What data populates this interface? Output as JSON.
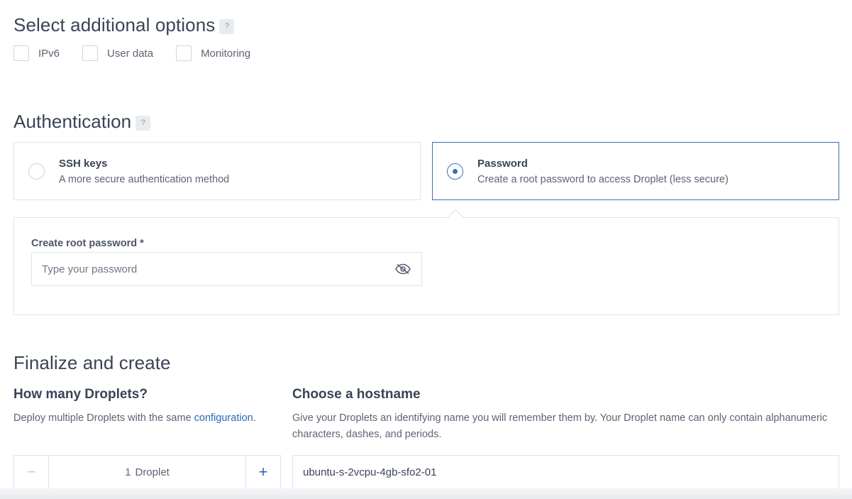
{
  "additional_options": {
    "heading": "Select additional options",
    "help": "?",
    "options": [
      {
        "label": "IPv6",
        "checked": false
      },
      {
        "label": "User data",
        "checked": false
      },
      {
        "label": "Monitoring",
        "checked": false
      }
    ]
  },
  "authentication": {
    "heading": "Authentication",
    "help": "?",
    "ssh": {
      "title": "SSH keys",
      "subtitle": "A more secure authentication method",
      "selected": false
    },
    "password": {
      "title": "Password",
      "subtitle": "Create a root password to access Droplet (less secure)",
      "selected": true
    },
    "root_password": {
      "label": "Create root password *",
      "placeholder": "Type your password",
      "value": ""
    }
  },
  "finalize": {
    "heading": "Finalize and create",
    "droplets": {
      "heading": "How many Droplets?",
      "desc_prefix": "Deploy multiple Droplets with the same ",
      "desc_link": "configuration",
      "desc_suffix": ".",
      "minus": "−",
      "plus": "+",
      "count": "1",
      "unit": "Droplet"
    },
    "hostname": {
      "heading": "Choose a hostname",
      "description": "Give your Droplets an identifying name you will remember them by. Your Droplet name can only contain alphanumeric characters, dashes, and periods.",
      "value": "ubuntu-s-2vcpu-4gb-sfo2-01"
    }
  },
  "colors": {
    "accent": "#3b6fb6",
    "link": "#2b66b3",
    "border": "#dfe3e8"
  }
}
